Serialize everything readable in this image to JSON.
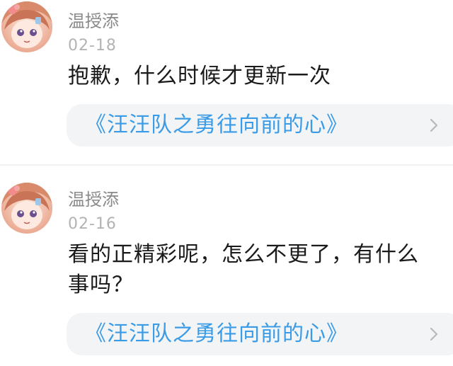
{
  "comments": [
    {
      "author": "温授添",
      "date": "02-18",
      "text": "抱歉，什么时候才更新一次",
      "book_title": "《汪汪队之勇往向前的心》",
      "chevron_icon": "chevron-right-icon"
    },
    {
      "author": "温授添",
      "date": "02-16",
      "text": "看的正精彩呢，怎么不更了，有什么事吗？",
      "book_title": "《汪汪队之勇往向前的心》",
      "chevron_icon": "chevron-right-icon"
    }
  ],
  "colors": {
    "author": "#8a8a8a",
    "date": "#b3b3b3",
    "text": "#1a1a1a",
    "link": "#3a9be6",
    "card_bg": "#f3f4f6"
  }
}
